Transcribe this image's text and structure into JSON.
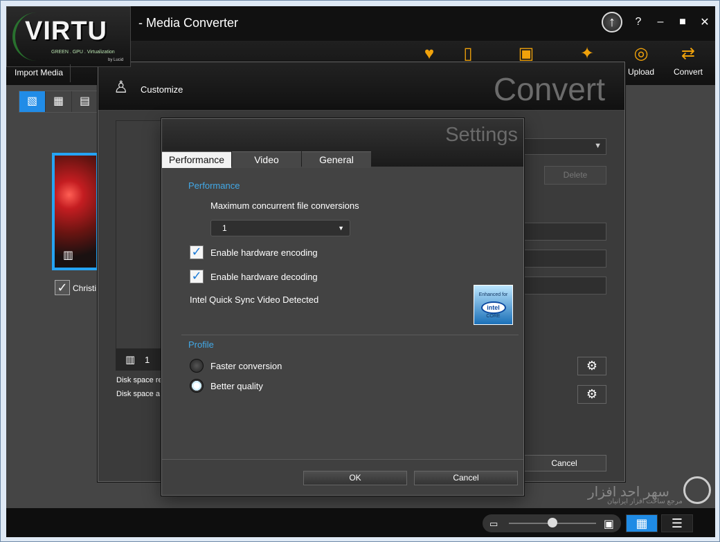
{
  "app": {
    "title": "- Media Converter",
    "upgrade_icon": "upgrade-icon",
    "help": "?",
    "minimize": "–",
    "maximize": "■",
    "close": "✕"
  },
  "logo": {
    "brand": "VIRTU",
    "tagline": "GREEN . GPU . Virtualization",
    "by": "by Lucid"
  },
  "toolbar": {
    "import_media": "Import Media",
    "upload": "Upload",
    "convert": "Convert",
    "icons": [
      "heart-icon",
      "device-icon",
      "camera-icon",
      "gamepad-icon",
      "globe-icon",
      "convert-arrows-icon"
    ]
  },
  "media_area": {
    "thumbnail_label": "Christi"
  },
  "convert_dialog": {
    "title_word": "Convert",
    "customize": "Customize",
    "delete": "Delete",
    "preview_count": "1",
    "disk_required": "Disk space re",
    "disk_available": "Disk space a",
    "cancel": "Cancel"
  },
  "settings": {
    "title_word": "Settings",
    "tabs": [
      {
        "label": "Performance"
      },
      {
        "label": "Video"
      },
      {
        "label": "General"
      }
    ],
    "performance": {
      "section": "Performance",
      "max_label": "Maximum concurrent file conversions",
      "max_value": "1",
      "hw_encoding": "Enable hardware encoding",
      "hw_decoding": "Enable hardware decoding",
      "detected": "Intel Quick Sync Video Detected"
    },
    "profile": {
      "section": "Profile",
      "faster": "Faster conversion",
      "better": "Better quality"
    },
    "ok": "OK",
    "cancel": "Cancel"
  },
  "intel_badge": {
    "enhanced": "Enhanced for",
    "brand": "intel",
    "core": "CORE"
  },
  "watermark": {
    "brand": "سهر احد افزار",
    "sub": "مرجع ساخت افزار ایرانیان"
  }
}
